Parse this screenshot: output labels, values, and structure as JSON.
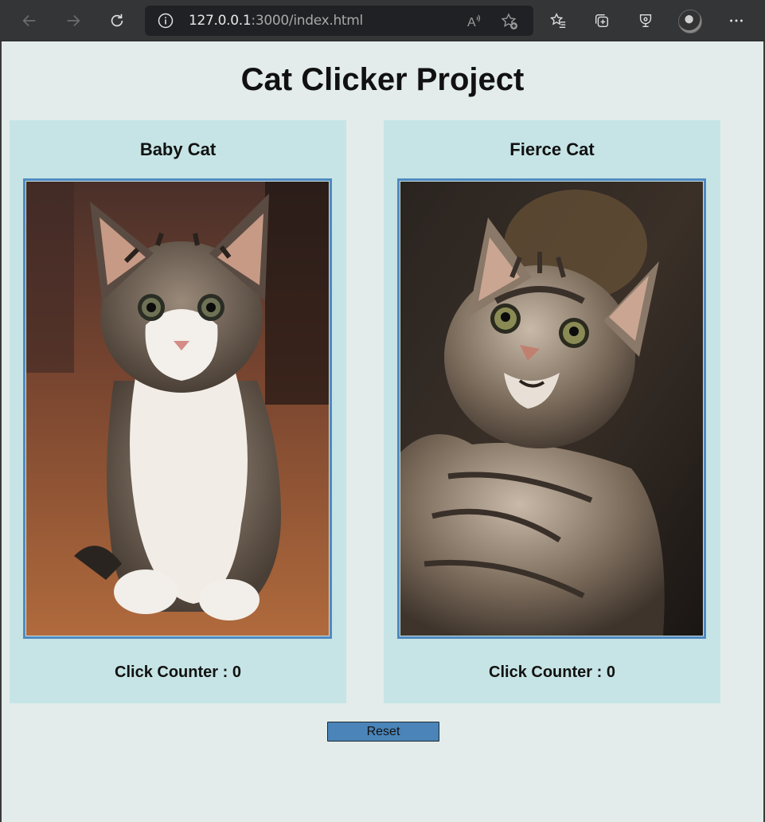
{
  "browser": {
    "url_host": "127.0.0.1",
    "url_rest": ":3000/index.html"
  },
  "page": {
    "title": "Cat Clicker Project"
  },
  "cats": [
    {
      "name": "Baby Cat",
      "counter_label": "Click Counter : ",
      "count": 0
    },
    {
      "name": "Fierce Cat",
      "counter_label": "Click Counter : ",
      "count": 0
    }
  ],
  "reset_label": "Reset",
  "icons": {
    "back": "back-arrow-icon",
    "forward": "forward-arrow-icon",
    "refresh": "refresh-icon",
    "info": "info-icon",
    "read_aloud": "read-aloud-icon",
    "add_favorite": "add-favorite-icon",
    "favorites": "favorites-icon",
    "collections": "collections-icon",
    "extensions": "extensions-icon",
    "more": "more-icon"
  },
  "colors": {
    "page_bg": "#e3ecea",
    "card_bg": "#c6e4e5",
    "photo_border": "#4f8ac1",
    "reset_bg": "#4a84b8"
  }
}
